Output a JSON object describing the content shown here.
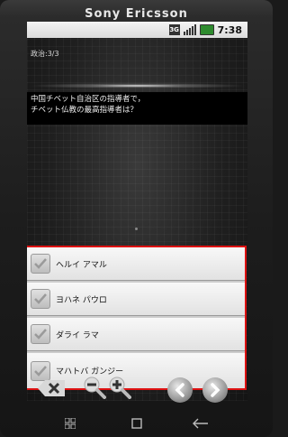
{
  "device": {
    "brand": "Sony Ericsson"
  },
  "statusbar": {
    "network": "3G",
    "time": "7:38"
  },
  "quiz": {
    "category": "政治:3/3",
    "question": "中国チベット自治区の指導者で，\nチベット仏教の最高指導者は？",
    "answers": [
      {
        "label": "ヘルイ アマル"
      },
      {
        "label": "ヨハネ パウロ"
      },
      {
        "label": "ダライ ラマ"
      },
      {
        "label": "マハトバ ガンジー"
      }
    ]
  },
  "toolbar": {
    "icons": [
      "delete-icon",
      "zoom-out-icon",
      "zoom-in-icon",
      "previous-icon",
      "next-icon"
    ]
  },
  "navbar": {
    "icons": [
      "recent-apps-icon",
      "home-icon",
      "back-icon"
    ]
  },
  "colors": {
    "highlight_border": "#d11111",
    "nav_button": "#8a8a8a"
  }
}
